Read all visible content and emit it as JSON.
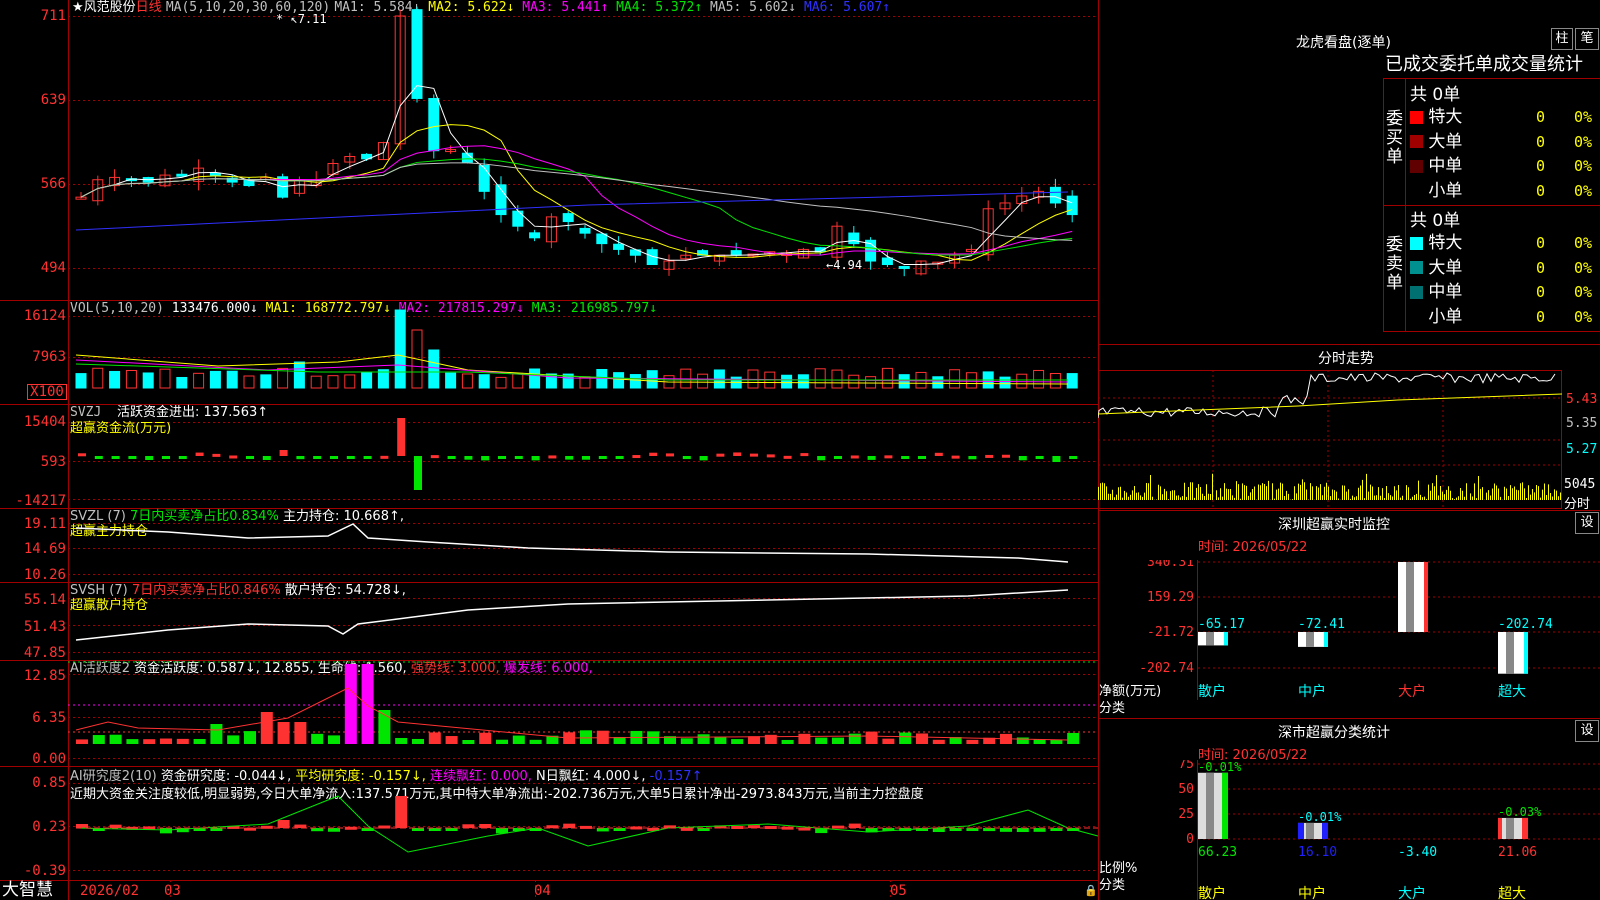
{
  "colors": {
    "up": "#ff3232",
    "down": "#00ffff",
    "ma5": "#ffffff",
    "ma10": "#ffff00",
    "ma20": "#ff00ff",
    "ma30": "#00e600",
    "ma60": "#c0c0c0",
    "ma120": "#3030ff",
    "grid": "#a00000",
    "bg": "#000000"
  },
  "icons": {
    "star": "star-icon",
    "lock": "lock-icon"
  },
  "main": {
    "star": "★",
    "name": "风范股份",
    "period": "日线",
    "ma_params": "MA(5,10,20,30,60,120)",
    "ma": [
      {
        "label": "MA1: 5.584↓",
        "color": "#c0c0c0"
      },
      {
        "label": "MA2: 5.622↓",
        "color": "#ffff00"
      },
      {
        "label": "MA3: 5.441↑",
        "color": "#ff00ff"
      },
      {
        "label": "MA4: 5.372↑",
        "color": "#00e600"
      },
      {
        "label": "MA5: 5.602↓",
        "color": "#c0c0c0"
      },
      {
        "label": "MA6: 5.607↑",
        "color": "#3030ff"
      }
    ],
    "yticks": [
      "711",
      "639",
      "566",
      "494"
    ],
    "high_label": "7.11",
    "low_label": "←4.94"
  },
  "vol": {
    "title": "VOL(5,10,20)",
    "value": "133476.000↓",
    "ma1": "MA1: 168772.797↓",
    "ma2": "MA2: 217815.297↓",
    "ma3": "MA3: 216985.797↓",
    "yticks": [
      "16124",
      "7963"
    ],
    "unit": "X100"
  },
  "svzj": {
    "title": "SVZJ",
    "label": "活跃资金进出: 137.563↑",
    "sub": "超赢资金流(万元)",
    "yticks": [
      "15404",
      "593",
      "-14217"
    ]
  },
  "svzl": {
    "title": "SVZL (7)",
    "l1": "7日内买卖净占比0.834%",
    "l2": "主力持仓: 10.668↑,",
    "sub": "超赢主力持仓",
    "yticks": [
      "19.11",
      "14.69",
      "10.26"
    ]
  },
  "svsh": {
    "title": "SVSH (7)",
    "l1": "7日内买卖净占比0.846%",
    "l2": "散户持仓: 54.728↓,",
    "sub": "超赢散户持仓",
    "yticks": [
      "55.14",
      "51.43",
      "47.85"
    ]
  },
  "ai1": {
    "title": "AI活跃度2",
    "l1": "资金活跃度: 0.587↓,",
    "l2": "12.855,",
    "l3": "生命线: 1.560,",
    "l4": "强势线: 3.000,",
    "l5": "爆发线: 6.000,",
    "yticks": [
      "12.85",
      "6.35",
      "0.00"
    ]
  },
  "ai2": {
    "title": "AI研究度2(10)",
    "l1": "资金研究度: -0.044↓,",
    "l2": "平均研究度: -0.157↓,",
    "l3": "连续飘红: 0.000,",
    "l4": "N日飘红: 4.000↓,",
    "l5": "-0.157↑",
    "comment": "近期大资金关注度较低,明显弱势,今日大单净流入:137.571万元,其中特大单净流出:-202.736万元,大单5日累计净出-2973.843万元,当前主力控盘度",
    "yticks": [
      "0.85",
      "0.23",
      "-0.39"
    ]
  },
  "xaxis": {
    "brand": "大智慧",
    "labels": [
      "2026/02",
      "03",
      "04",
      "05"
    ]
  },
  "lhb": {
    "title": "龙虎看盘(逐单)",
    "btn_bar": "柱",
    "btn_pen": "笔",
    "subtitle": "已成交委托单成交量统计",
    "buy": {
      "side": "委买单",
      "total": "共 0单",
      "rows": [
        {
          "name": "特大",
          "v": "0",
          "p": "0%",
          "c": "#ff0000"
        },
        {
          "name": "大单",
          "v": "0",
          "p": "0%",
          "c": "#a00000"
        },
        {
          "name": "中单",
          "v": "0",
          "p": "0%",
          "c": "#600000"
        },
        {
          "name": "小单",
          "v": "0",
          "p": "0%",
          "c": "#000000"
        }
      ]
    },
    "sell": {
      "side": "委卖单",
      "total": "共 0单",
      "rows": [
        {
          "name": "特大",
          "v": "0",
          "p": "0%",
          "c": "#00ffff"
        },
        {
          "name": "大单",
          "v": "0",
          "p": "0%",
          "c": "#009090"
        },
        {
          "name": "中单",
          "v": "0",
          "p": "0%",
          "c": "#007070"
        },
        {
          "name": "小单",
          "v": "0",
          "p": "0%",
          "c": "#000000"
        }
      ]
    }
  },
  "intraday": {
    "title": "分时走势",
    "yticks": [
      "5.43",
      "5.35",
      "5.27"
    ],
    "vol_tick": "5045",
    "vol_unit": "分时"
  },
  "monitor": {
    "title": "深圳超赢实时监控",
    "btn": "设",
    "time": "时间: 2026/05/22",
    "yticks": [
      "340.31",
      "159.29",
      "-21.72",
      "-202.74"
    ],
    "ylabel": "净额(万元)",
    "xlabel": "分类",
    "cats": [
      "散户",
      "中户",
      "大户",
      "超大"
    ],
    "vals": [
      "-65.17",
      "-72.41",
      "340.31",
      "-202.74"
    ]
  },
  "classify": {
    "title": "深市超赢分类统计",
    "btn": "设",
    "time": "时间: 2026/05/22",
    "yticks": [
      "75",
      "50",
      "25",
      "0"
    ],
    "ylabel": "比例%",
    "xlabel": "分类",
    "cats": [
      "散户",
      "中户",
      "大户",
      "超大"
    ],
    "tops": [
      "-0.01%",
      "-0.01%",
      "",
      "-0.03%"
    ],
    "vals": [
      "66.23",
      "16.10",
      "-3.40",
      "21.06"
    ]
  }
}
